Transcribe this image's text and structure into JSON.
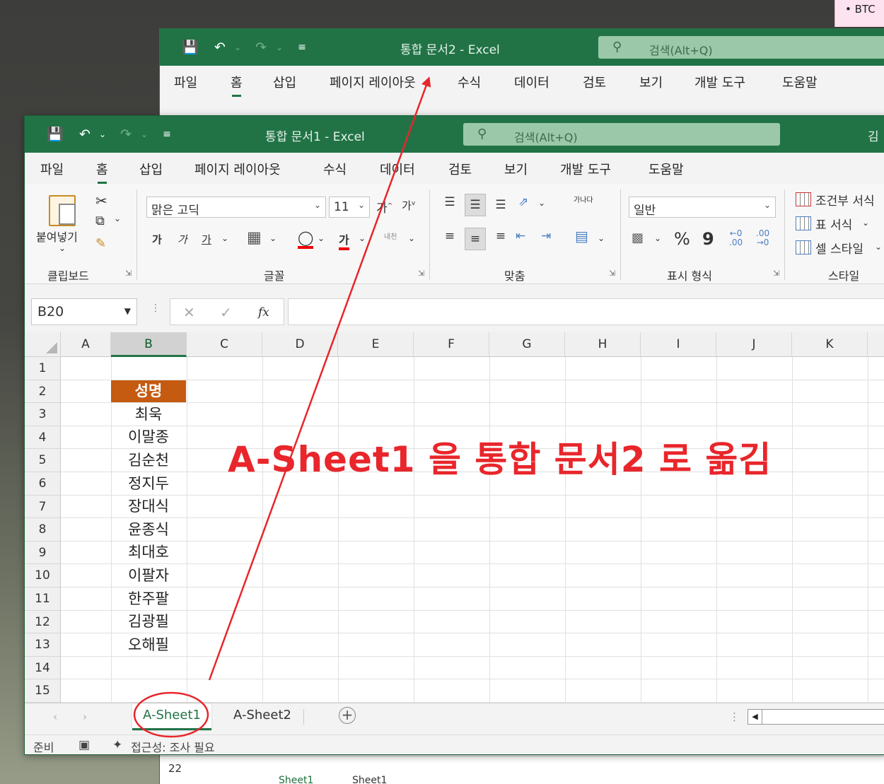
{
  "background": {
    "sticky_note": "• BTC"
  },
  "window2": {
    "title": "통합 문서2  -  Excel",
    "search_placeholder": "검색(Alt+Q)",
    "menu": [
      "파일",
      "홈",
      "삽입",
      "페이지 레이아웃",
      "수식",
      "데이터",
      "검토",
      "보기",
      "개발 도구",
      "도움말"
    ],
    "active_menu": "홈",
    "visible_row": "22",
    "tabs": [
      "Sheet1",
      "Sheet1"
    ]
  },
  "window1": {
    "title": "통합 문서1  -  Excel",
    "search_placeholder": "검색(Alt+Q)",
    "user_initial": "김",
    "menu": [
      "파일",
      "홈",
      "삽입",
      "페이지 레이아웃",
      "수식",
      "데이터",
      "검토",
      "보기",
      "개발 도구",
      "도움말"
    ],
    "active_menu": "홈",
    "ribbon": {
      "clipboard": {
        "paste_label": "붙여넣기",
        "group_label": "클립보드"
      },
      "font": {
        "font_name": "맑은 고딕",
        "font_size": "11",
        "group_label": "글꼴",
        "bold": "가",
        "italic": "가",
        "underline": "가",
        "text_color": "가",
        "wrap_small": "내천"
      },
      "alignment": {
        "group_label": "맞춤",
        "wrap": "가나다"
      },
      "number": {
        "format": "일반",
        "group_label": "표시 형식",
        "percent": "%",
        "comma": "9"
      },
      "styles": {
        "conditional": "조건부 서식",
        "table": "표 서식",
        "cell": "셀 스타일",
        "group_label": "스타일"
      }
    },
    "formula_bar": {
      "name_box": "B20",
      "fx": "fx",
      "formula": ""
    },
    "columns": [
      "A",
      "B",
      "C",
      "D",
      "E",
      "F",
      "G",
      "H",
      "I",
      "J",
      "K"
    ],
    "selected_column": "B",
    "rows": [
      "1",
      "2",
      "3",
      "4",
      "5",
      "6",
      "7",
      "8",
      "9",
      "10",
      "11",
      "12",
      "13",
      "14",
      "15"
    ],
    "column_b_cells": [
      "",
      "성명",
      "최욱",
      "이말종",
      "김순천",
      "정지두",
      "장대식",
      "윤종식",
      "최대호",
      "이팔자",
      "한주팔",
      "김광필",
      "오해필",
      "",
      ""
    ],
    "header_fill": "#c55a11",
    "sheet_tabs": [
      "A-Sheet1",
      "A-Sheet2"
    ],
    "active_sheet": "A-Sheet1",
    "status": {
      "ready": "준비",
      "accessibility": "접근성: 조사 필요"
    }
  },
  "annotation": {
    "text": "A-Sheet1 을 통합 문서2 로 옮김",
    "color": "#e8262b"
  }
}
